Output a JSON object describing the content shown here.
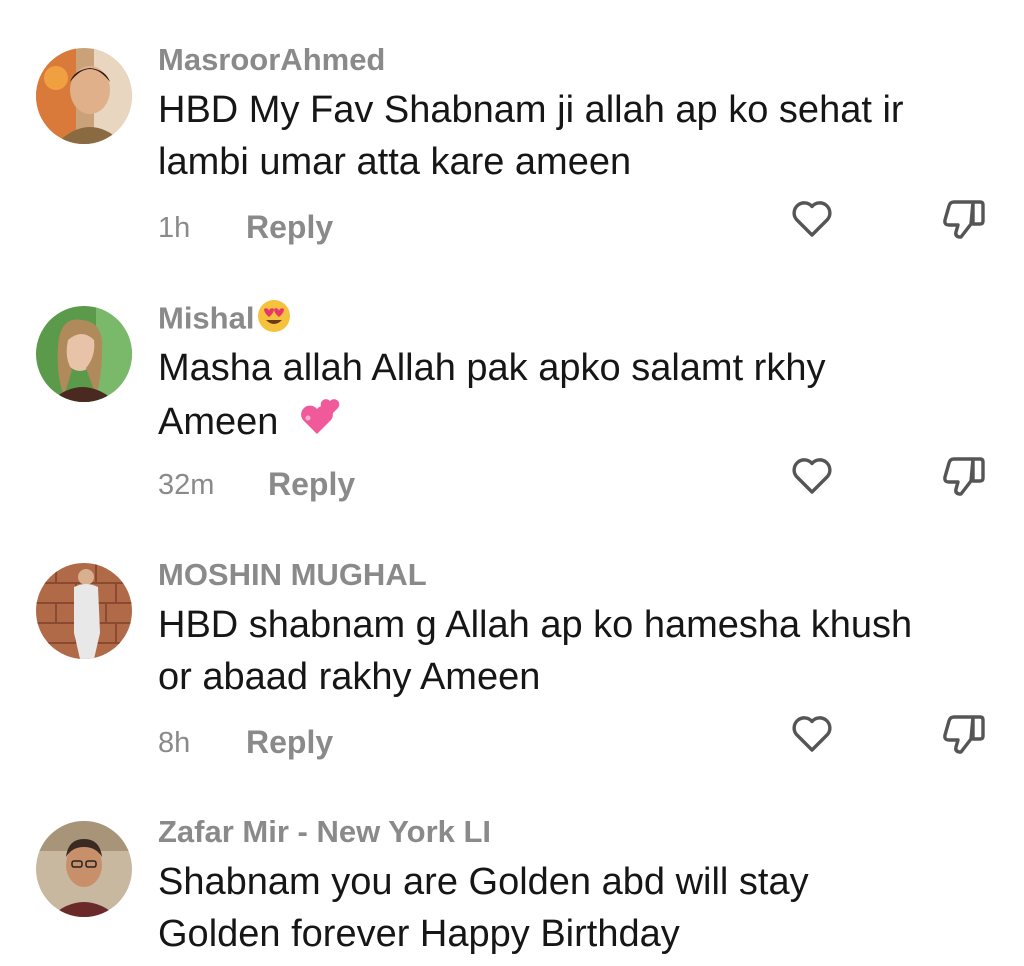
{
  "comments": [
    {
      "username": "MasroorAhmed",
      "text_lines": [
        "HBD My Fav Shabnam ji allah ap ko sehat ir",
        "lambi umar atta kare ameen"
      ],
      "time": "1h",
      "reply_label": "Reply",
      "like_icon": "heart-outline-icon",
      "dislike_icon": "thumbs-down-outline-icon"
    },
    {
      "username": "Mishal",
      "username_emoji": "smiling-face-with-heart-eyes-emoji",
      "text_lines": [
        "Masha allah Allah pak apko salamt rkhy",
        "Ameen"
      ],
      "text_emoji": "two-hearts-emoji",
      "time": "32m",
      "reply_label": "Reply",
      "like_icon": "heart-outline-icon",
      "dislike_icon": "thumbs-down-outline-icon"
    },
    {
      "username": "MOSHIN MUGHAL",
      "text_lines": [
        "HBD shabnam g Allah ap ko hamesha khush",
        "or abaad rakhy Ameen"
      ],
      "time": "8h",
      "reply_label": "Reply",
      "like_icon": "heart-outline-icon",
      "dislike_icon": "thumbs-down-outline-icon"
    },
    {
      "username": "Zafar Mir - New York LI",
      "text_lines": [
        "Shabnam you are Golden abd will stay",
        "Golden forever Happy Birthday"
      ]
    }
  ],
  "colors": {
    "username": "#8a8a8a",
    "text": "#161616",
    "meta": "#8a8a8a",
    "icon_stroke": "#555555",
    "background": "#ffffff"
  }
}
